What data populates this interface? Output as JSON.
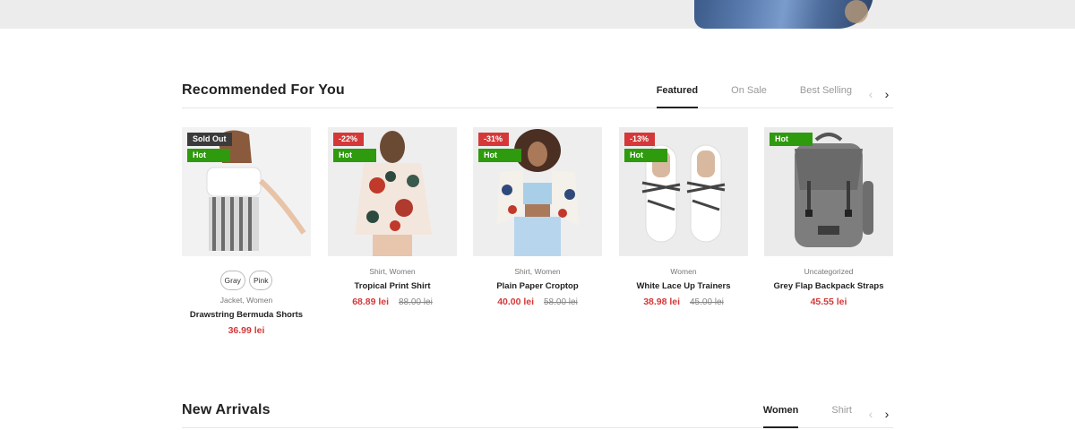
{
  "recommended": {
    "title": "Recommended For You",
    "tabs": [
      {
        "label": "Featured",
        "active": true
      },
      {
        "label": "On Sale",
        "active": false
      },
      {
        "label": "Best Selling",
        "active": false
      }
    ],
    "prev_icon": "chevron-left-icon",
    "next_icon": "chevron-right-icon",
    "products": [
      {
        "badges": [
          {
            "text": "Sold Out",
            "type": "sold"
          },
          {
            "text": "Hot",
            "type": "hot"
          }
        ],
        "swatches": [
          "Gray",
          "Pink"
        ],
        "categories": "Jacket, Women",
        "name": "Drawstring Bermuda Shorts",
        "price": "36.99 lei",
        "old_price": ""
      },
      {
        "badges": [
          {
            "text": "-22%",
            "type": "sale"
          },
          {
            "text": "Hot",
            "type": "hot"
          }
        ],
        "swatches": [],
        "categories": "Shirt, Women",
        "name": "Tropical Print Shirt",
        "price": "68.89 lei",
        "old_price": "88.00 lei"
      },
      {
        "badges": [
          {
            "text": "-31%",
            "type": "sale"
          },
          {
            "text": "Hot",
            "type": "hot"
          }
        ],
        "swatches": [],
        "categories": "Shirt, Women",
        "name": "Plain Paper Croptop",
        "price": "40.00 lei",
        "old_price": "58.00 lei"
      },
      {
        "badges": [
          {
            "text": "-13%",
            "type": "sale"
          },
          {
            "text": "Hot",
            "type": "hot"
          }
        ],
        "swatches": [],
        "categories": "Women",
        "name": "White Lace Up Trainers",
        "price": "38.98 lei",
        "old_price": "45.00 lei"
      },
      {
        "badges": [
          {
            "text": "Hot",
            "type": "hot"
          }
        ],
        "swatches": [],
        "categories": "Uncategorized",
        "name": "Grey Flap Backpack Straps",
        "price": "45.55 lei",
        "old_price": ""
      }
    ]
  },
  "new_arrivals": {
    "title": "New Arrivals",
    "tabs": [
      {
        "label": "Women",
        "active": true
      },
      {
        "label": "Shirt",
        "active": false
      }
    ]
  },
  "colors": {
    "accent_price": "#d43838",
    "badge_hot": "#2e9a0d",
    "badge_sale": "#d43838",
    "badge_sold_out": "#3b3b3b"
  }
}
